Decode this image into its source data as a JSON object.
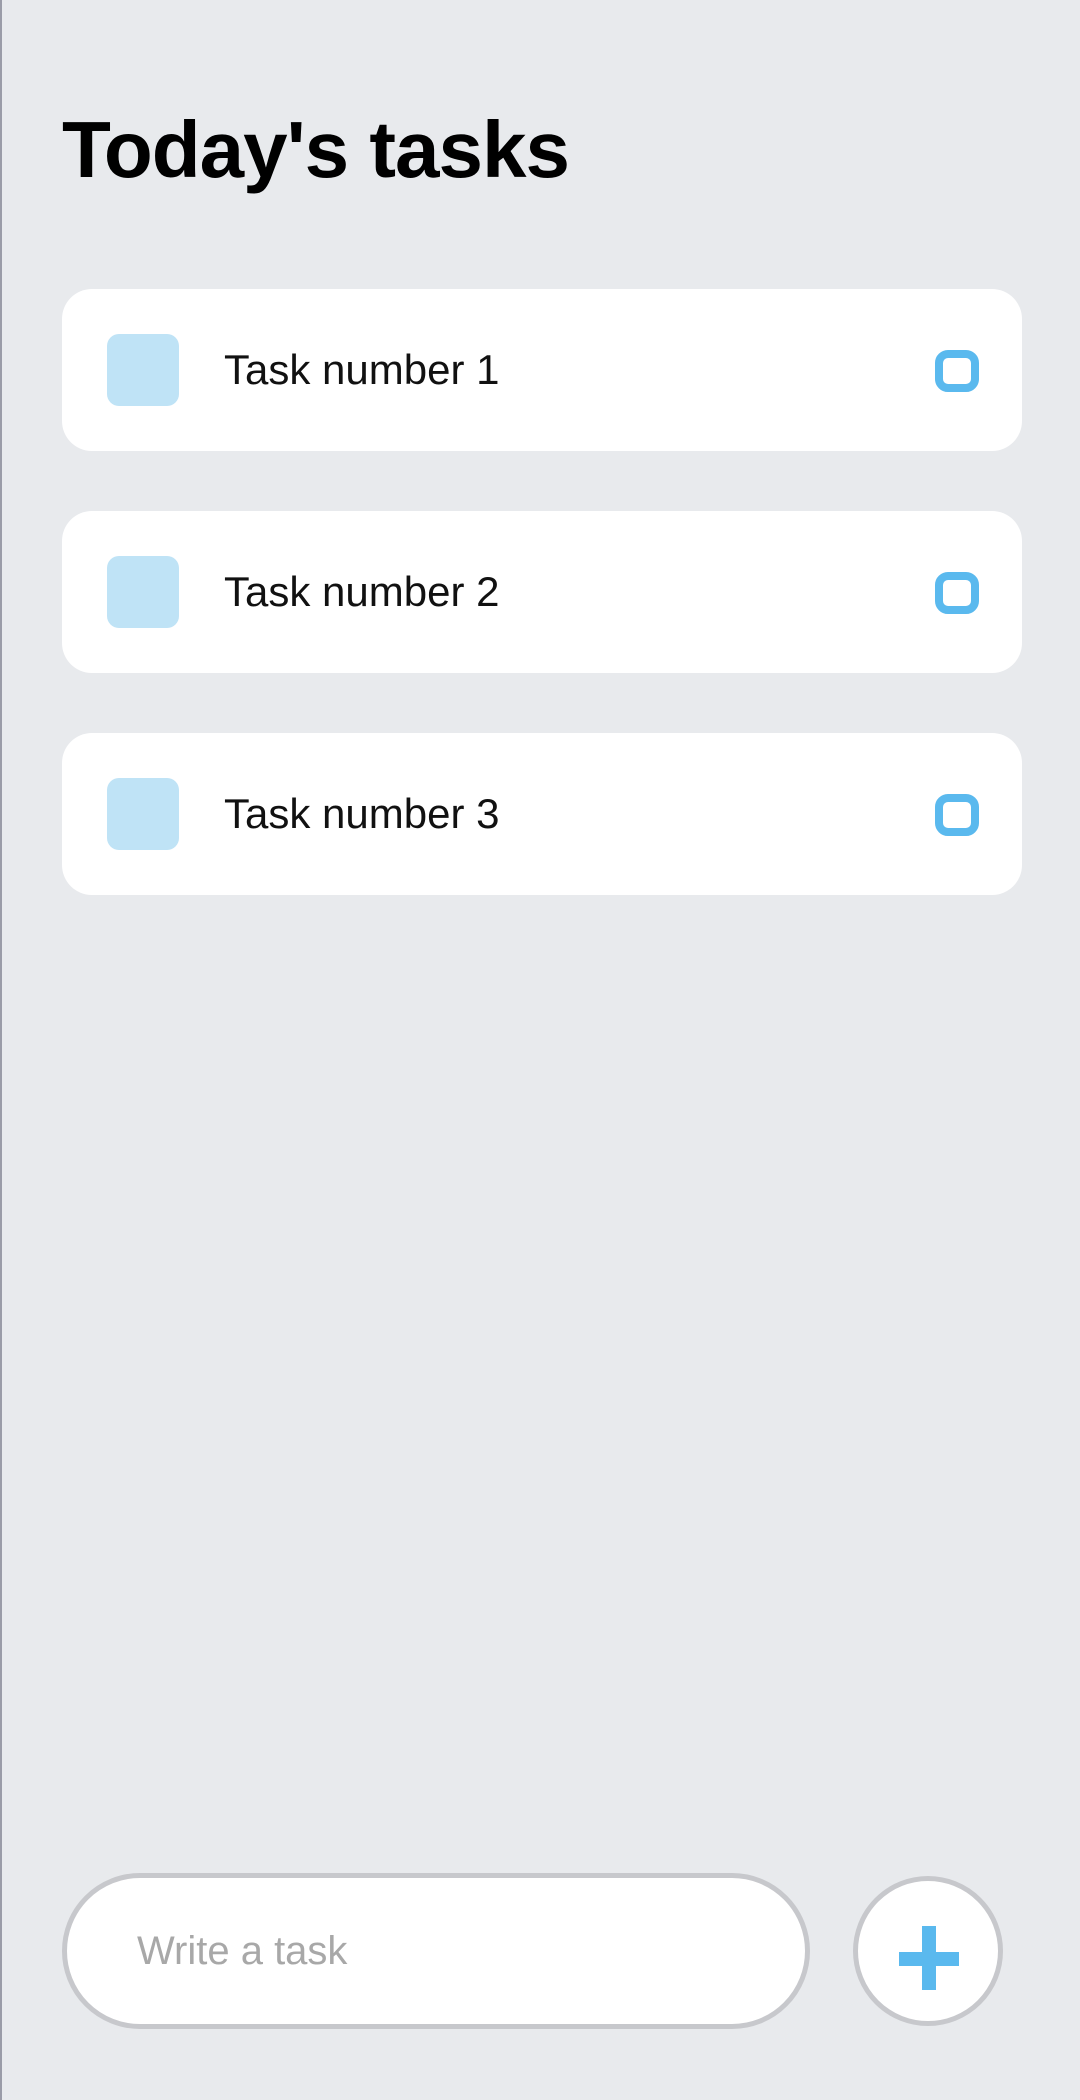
{
  "header": {
    "title": "Today's tasks"
  },
  "tasks": [
    {
      "label": "Task number 1"
    },
    {
      "label": "Task number 2"
    },
    {
      "label": "Task number 3"
    }
  ],
  "composer": {
    "placeholder": "Write a task",
    "value": "",
    "add_icon": "plus-icon"
  },
  "colors": {
    "background": "#e8eaed",
    "card": "#ffffff",
    "square": "#bfe3f6",
    "accent": "#5ab9ee",
    "border": "#c7c8cc"
  }
}
